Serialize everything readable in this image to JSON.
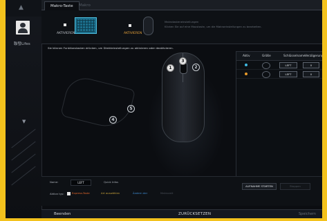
{
  "sidebar": {
    "profile_label": "聯發Lifes"
  },
  "tabs": [
    {
      "label": "Makro-Taste"
    },
    {
      "label": "Makro"
    }
  ],
  "toprow": {
    "keyboard_action": "AKTIVIEREN",
    "mouse_action": "AKTIVIEREN",
    "info_title": "Makrotasteneinstellungen",
    "info_desc": "Klicken Sie auf eine Maustaste, um die Makroeinstellungen zu bearbeiten."
  },
  "instruction": "Sie können Funktionstasten drücken, um Direkteinstellungen zu aktivieren oder deaktivieren.",
  "mouse_buttons": [
    "1",
    "2",
    "3",
    "4",
    "5"
  ],
  "key_table": {
    "headers": [
      "Aktiv",
      "Größe",
      "Schlüsselname",
      "Verzögerungszeit"
    ],
    "rows": [
      {
        "dot_color": "#3fb8e0",
        "key": "LEFT",
        "delay": "0"
      },
      {
        "dot_color": "#e89a2a",
        "key": "LEFT",
        "delay": "0"
      }
    ]
  },
  "bottom": {
    "name_label": "Name:",
    "name_value": "LEFT",
    "quick_info_label": "Quick Infos",
    "record_start": "AUFNAHME STARTEN",
    "record_stop": "Stoppen",
    "action_type_label": "Aktion typ:",
    "options": [
      "Express-Taste",
      "Art auswählen",
      "Ändern der",
      "Makrozeit"
    ]
  },
  "status": {
    "exit": "Beenden",
    "reset": "ZURÜCKSETZEN",
    "save": "Speichern"
  }
}
